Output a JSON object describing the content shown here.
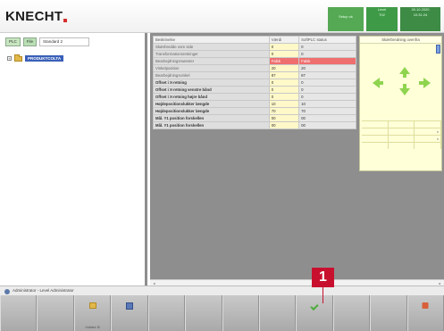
{
  "brand": {
    "logo": "KNECHT"
  },
  "header": {
    "status_1": "Setup ok",
    "status_2_line1": "Level",
    "status_2_line2": "702",
    "status_3_line1": "30.10.2020",
    "status_3_line2": "10:31:24"
  },
  "tree": {
    "tab_plc": "PLC",
    "tab_file": "File",
    "tab_standard": "Standard 2",
    "root_node": "PRODUKTCOLTA"
  },
  "table": {
    "headers": [
      "Beskrivelse",
      "Værdi",
      "SoftPLC status"
    ],
    "rows": [
      {
        "name": "Skærbredde ovre side",
        "value": "0",
        "status": "0",
        "alert": false,
        "bold": false
      },
      {
        "name": "Transformationsretninger",
        "value": "0",
        "status": "0",
        "alert": false,
        "bold": false
      },
      {
        "name": "Bearbejdningsmønster",
        "value": "Falsk",
        "status": "Falsk",
        "alert": true,
        "bold": false
      },
      {
        "name": "Vinkelposition",
        "value": "20",
        "status": "20",
        "alert": false,
        "bold": false
      },
      {
        "name": "Bearbejdningsvinkel",
        "value": "87",
        "status": "87",
        "alert": false,
        "bold": false
      },
      {
        "name": "Offset i X-retning",
        "value": "0",
        "status": "0",
        "alert": false,
        "bold": true
      },
      {
        "name": "Offset i X-retning venstre bånd",
        "value": "0",
        "status": "0",
        "alert": false,
        "bold": true
      },
      {
        "name": "Offset i X-retning højre bånd",
        "value": "0",
        "status": "0",
        "alert": false,
        "bold": true
      },
      {
        "name": "Højdepositionslukker længde",
        "value": "10",
        "status": "10",
        "alert": false,
        "bold": true
      },
      {
        "name": "Højdepositionslukker længde",
        "value": "70",
        "status": "70",
        "alert": false,
        "bold": true
      },
      {
        "name": "Mål. Y1 position forskellen",
        "value": "00",
        "status": "00",
        "alert": false,
        "bold": true
      },
      {
        "name": "Mål. Y1 position forskellen",
        "value": "00",
        "status": "00",
        "alert": false,
        "bold": true
      }
    ]
  },
  "preview": {
    "title": "Skærbredning ovenfra",
    "grid_marks": [
      "x",
      "x"
    ]
  },
  "status_bar": {
    "text": "Administrator - Level Administrator"
  },
  "softkeys": {
    "load_label": "Indlæs fil",
    "callout_number": "1"
  },
  "colors": {
    "status_green": "#55a955",
    "alert_red": "#ef6e6e",
    "callout_red": "#c8102e",
    "selection_blue": "#3a5fb8",
    "value_yellow": "#fff8c8"
  }
}
